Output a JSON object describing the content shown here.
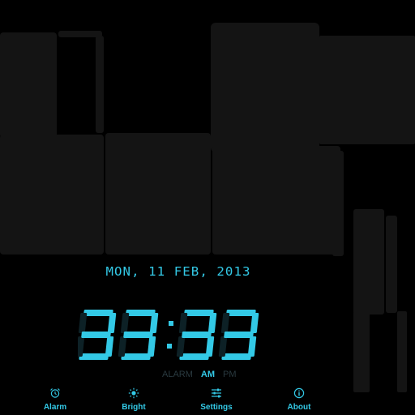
{
  "display": {
    "date": "MON, 11 FEB, 2013",
    "time": "33:33"
  },
  "mode": {
    "alarm_label": "ALARM",
    "am_label": "AM",
    "pm_label": "PM",
    "active": "AM"
  },
  "bottom_bar": {
    "items": [
      {
        "label": "Alarm",
        "icon": "alarm-clock-icon"
      },
      {
        "label": "Bright",
        "icon": "sun-icon"
      },
      {
        "label": "Settings",
        "icon": "sliders-icon"
      },
      {
        "label": "About",
        "icon": "info-icon"
      }
    ]
  },
  "colors": {
    "accent": "#33c9e6",
    "background": "#000000",
    "ghost_segment": "#141414",
    "dim_text": "#2a3a40"
  }
}
